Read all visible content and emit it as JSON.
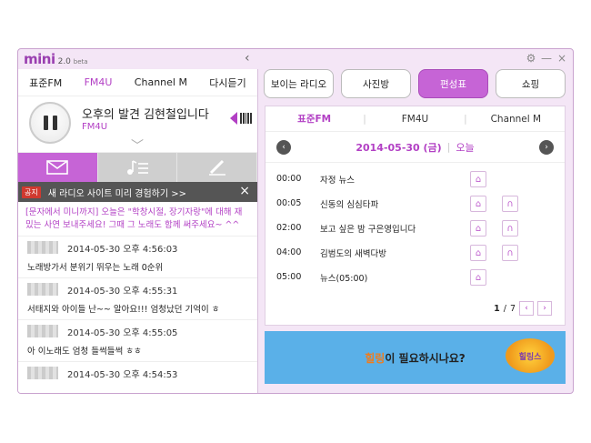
{
  "app": {
    "logo_text": "mini",
    "logo_version": "2.0",
    "logo_beta": "beta",
    "collapse_icon": "‹",
    "window_buttons": [
      "⚙",
      "—",
      "×"
    ]
  },
  "left": {
    "channel_tabs": [
      "표준FM",
      "FM4U",
      "Channel M",
      "다시듣기"
    ],
    "active_channel_index": 1,
    "now_playing": {
      "title": "오후의 발견 김현철입니다",
      "channel": "FM4U"
    },
    "tools": [
      {
        "icon": "mail-icon"
      },
      {
        "icon": "playlist-icon"
      },
      {
        "icon": "pencil-icon"
      }
    ],
    "notice": {
      "badge": "공지",
      "text": "새 라디오 사이트 미리 경험하기 >>",
      "close": "×"
    },
    "pinned_message": "[문자에서 미니까지] 오늘은 \"학창시절, 장기자랑\"에 대해 재밌는 사연 보내주세요! 그때 그 노래도 함께 써주세요~ ^^",
    "messages": [
      {
        "time": "2014-05-30 오후 4:56:03",
        "text": "노래방가서 분위기 뛰우는 노래 0순위"
      },
      {
        "time": "2014-05-30 오후 4:55:31",
        "text": "서태지와 아이들 난~~ 알아요!!! 엄청났던 기억이 ㅎ"
      },
      {
        "time": "2014-05-30 오후 4:55:05",
        "text": "아 이노래도 엄청 들썩들썩 ㅎㅎ"
      },
      {
        "time": "2014-05-30 오후 4:54:53",
        "text": ""
      }
    ]
  },
  "right": {
    "top_buttons": [
      "보이는 라디오",
      "사진방",
      "편성표",
      "쇼핑"
    ],
    "active_top_index": 2,
    "schedule": {
      "tabs": [
        "표준FM",
        "FM4U",
        "Channel M"
      ],
      "active_tab_index": 0,
      "date": "2014-05-30 (금)",
      "today_label": "오늘",
      "prev": "‹",
      "next": "›",
      "items": [
        {
          "time": "00:00",
          "name": "자정 뉴스",
          "home": true,
          "listen": false
        },
        {
          "time": "00:05",
          "name": "신동의 심심타파",
          "home": true,
          "listen": true
        },
        {
          "time": "02:00",
          "name": "보고 싶은 밤 구은영입니다",
          "home": true,
          "listen": true
        },
        {
          "time": "04:00",
          "name": "김범도의 새벽다방",
          "home": true,
          "listen": true
        },
        {
          "time": "05:00",
          "name": "뉴스(05:00)",
          "home": true,
          "listen": false
        }
      ],
      "page_current": "1",
      "page_total": "7",
      "page_prev": "‹",
      "page_next": "›"
    },
    "banner": {
      "highlight": "힐링",
      "text": "이 필요하시나요?",
      "logo_text": "힐링스"
    }
  }
}
